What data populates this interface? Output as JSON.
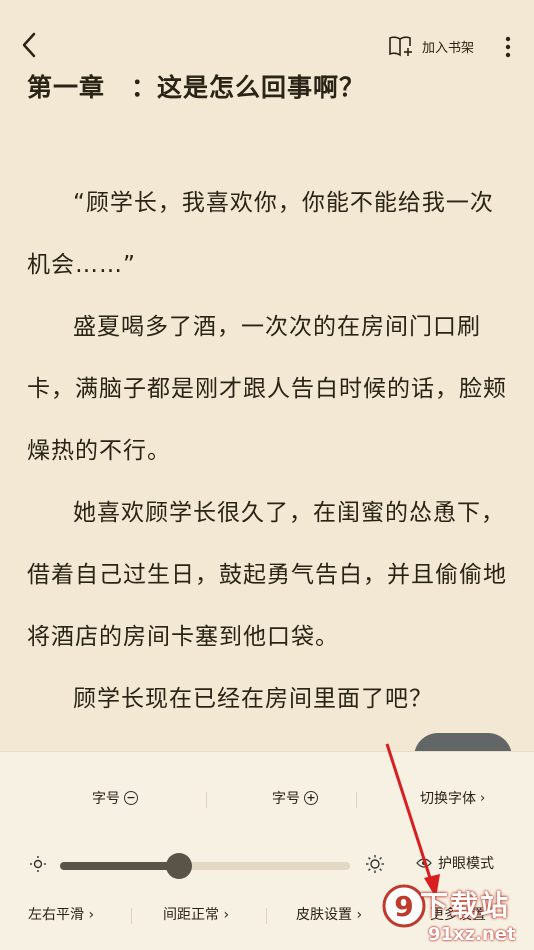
{
  "header": {
    "add_shelf_label": "加入书架"
  },
  "chapter": {
    "title": "第一章　：这是怎么回事啊？"
  },
  "paragraphs": [
    "“顾学长，我喜欢你，你能不能给我一次机会……”",
    "盛夏喝多了酒，一次次的在房间门口刷卡，满脑子都是刚才跟人告白时候的话，脸颊燥热的不行。",
    "她喜欢顾学长很久了，在闺蜜的怂恿下，借着自己过生日，鼓起勇气告白，并且偷偷地将酒店的房间卡塞到他口袋。",
    "顾学长现在已经在房间里面了吧？"
  ],
  "settings": {
    "font_size_minus_label": "字号",
    "font_size_plus_label": "字号",
    "switch_font_label": "切换字体",
    "brightness_level": 0.41,
    "eye_care_label": "护眼模式",
    "page_turn_label": "左右平滑",
    "spacing_label": "间距正常",
    "skin_label": "皮肤设置",
    "more_label": "更多设置"
  },
  "colors": {
    "page_bg": "#f2e8d3",
    "panel_bg": "#f7f1e4",
    "text": "#2b2416",
    "annotation_arrow": "#d81e1e"
  },
  "watermark": {
    "brand": "下载站",
    "domain": "91xz.net"
  }
}
